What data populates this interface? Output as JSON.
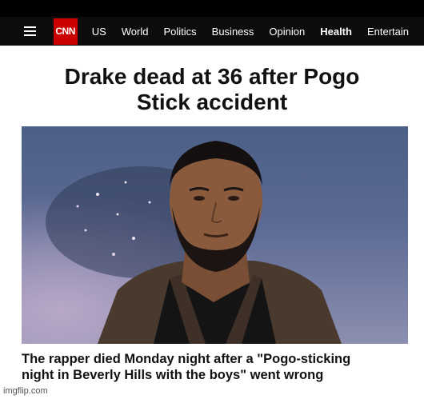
{
  "nav": {
    "logo": "CNN",
    "items": [
      "US",
      "World",
      "Politics",
      "Business",
      "Opinion",
      "Health",
      "Entertain"
    ]
  },
  "article": {
    "headline_line1": "Drake dead at 36 after Pogo",
    "headline_line2": "Stick accident",
    "caption_line1": "The rapper died Monday night after a \"Pogo-sticking",
    "caption_line2": "night in Beverly Hills with the boys\" went wrong"
  },
  "watermark": "imgflip.com",
  "colors": {
    "brand": "#cc0000",
    "nav_bg": "#0c0c0c"
  }
}
